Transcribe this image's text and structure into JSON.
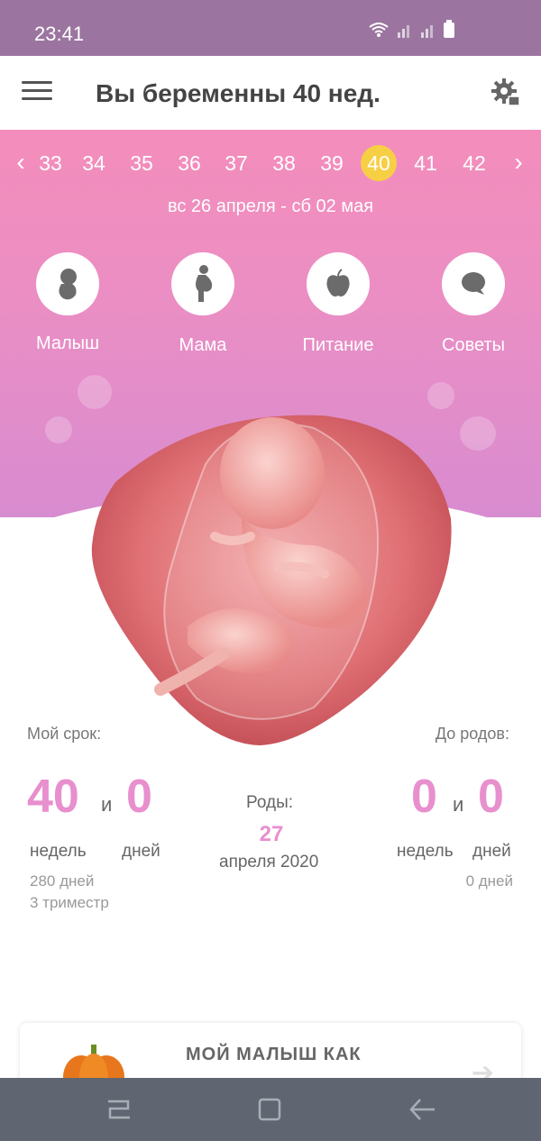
{
  "status": {
    "time": "23:41"
  },
  "appbar": {
    "title": "Вы беременны 40 нед."
  },
  "weeks": {
    "items": [
      "33",
      "34",
      "35",
      "36",
      "37",
      "38",
      "39",
      "40",
      "41",
      "42"
    ],
    "selected": "40",
    "range": "вс 26 апреля - сб 02 мая"
  },
  "features": [
    {
      "label": "Малыш",
      "icon": "baby-icon"
    },
    {
      "label": "Мама",
      "icon": "pregnant-woman-icon"
    },
    {
      "label": "Питание",
      "icon": "apple-icon"
    },
    {
      "label": "Советы",
      "icon": "speech-bubble-icon"
    }
  ],
  "term": {
    "title": "Мой срок:",
    "weeks": "40",
    "and": "и",
    "days": "0",
    "weeks_label": "недель",
    "days_label": "дней",
    "total_days": "280 дней",
    "trimester": "3 триместр"
  },
  "birth": {
    "title": "Роды:",
    "day": "27",
    "month_year": "апреля 2020"
  },
  "remaining": {
    "title": "До родов:",
    "weeks": "0",
    "and": "и",
    "days": "0",
    "weeks_label": "недель",
    "days_label": "дней",
    "total_days": "0 дней"
  },
  "card": {
    "title": "МОЙ МАЛЫШ КАК"
  },
  "colors": {
    "accent_pink": "#e88fce",
    "selected_week": "#f7cf45",
    "status_bar": "#9b759f"
  }
}
